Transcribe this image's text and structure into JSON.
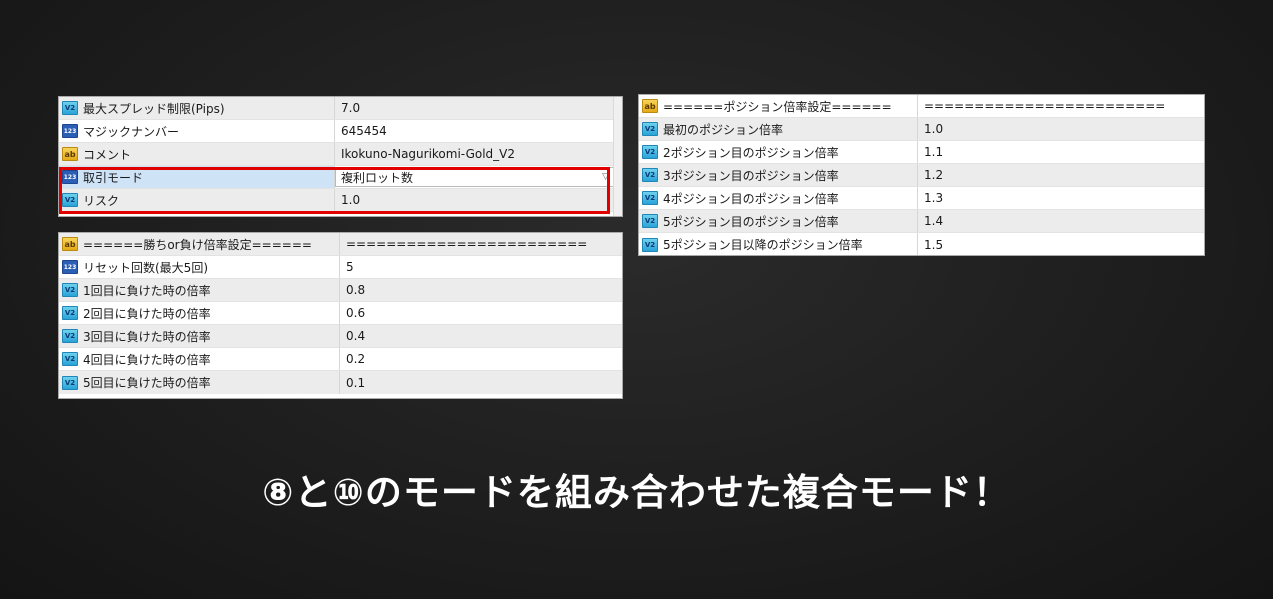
{
  "panel_general": {
    "rows": [
      {
        "icon": "fraction",
        "name": "最大スプレッド制限(Pips)",
        "value": "7.0"
      },
      {
        "icon": "integer",
        "name": "マジックナンバー",
        "value": "645454"
      },
      {
        "icon": "string",
        "name": "コメント",
        "value": "Ikokuno-Nagurikomi-Gold_V2"
      },
      {
        "icon": "integer",
        "name": "取引モード",
        "value": "複利ロット数"
      },
      {
        "icon": "fraction",
        "name": "リスク",
        "value": "1.0"
      }
    ]
  },
  "panel_winlose": {
    "rows": [
      {
        "icon": "string",
        "name": "======勝ちor負け倍率設定======",
        "value": "========================"
      },
      {
        "icon": "integer",
        "name": "リセット回数(最大5回)",
        "value": "5"
      },
      {
        "icon": "fraction",
        "name": "1回目に負けた時の倍率",
        "value": "0.8"
      },
      {
        "icon": "fraction",
        "name": "2回目に負けた時の倍率",
        "value": "0.6"
      },
      {
        "icon": "fraction",
        "name": "3回目に負けた時の倍率",
        "value": "0.4"
      },
      {
        "icon": "fraction",
        "name": "4回目に負けた時の倍率",
        "value": "0.2"
      },
      {
        "icon": "fraction",
        "name": "5回目に負けた時の倍率",
        "value": "0.1"
      }
    ]
  },
  "panel_position": {
    "rows": [
      {
        "icon": "string",
        "name": "======ポジション倍率設定======",
        "value": "========================"
      },
      {
        "icon": "fraction",
        "name": "最初のポジション倍率",
        "value": "1.0"
      },
      {
        "icon": "fraction",
        "name": "2ポジション目のポジション倍率",
        "value": "1.1"
      },
      {
        "icon": "fraction",
        "name": "3ポジション目のポジション倍率",
        "value": "1.2"
      },
      {
        "icon": "fraction",
        "name": "4ポジション目のポジション倍率",
        "value": "1.3"
      },
      {
        "icon": "fraction",
        "name": "5ポジション目のポジション倍率",
        "value": "1.4"
      },
      {
        "icon": "fraction",
        "name": "5ポジション目以降のポジション倍率",
        "value": "1.5"
      }
    ]
  },
  "icons": {
    "fraction": "V2",
    "integer": "123",
    "string": "ab"
  },
  "colors": {
    "highlight": "#e00000",
    "selected_row": "#cfe3f6",
    "background": "#1e1e1e"
  },
  "caption": "⑧と⑩のモードを組み合わせた複合モード！"
}
